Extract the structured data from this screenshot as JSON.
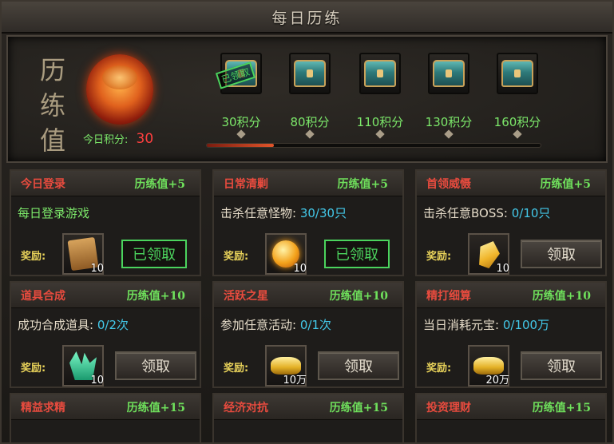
{
  "window": {
    "title": "每日历练"
  },
  "header": {
    "calligraphy": [
      "历",
      "练",
      "值"
    ],
    "today_score_label": "今日积分:",
    "today_score_value": "30",
    "progress_value": 0.2,
    "chests": [
      {
        "label": "30积分",
        "stamp": "已领取",
        "claimed": true
      },
      {
        "label": "80积分",
        "claimed": false
      },
      {
        "label": "110积分",
        "claimed": false
      },
      {
        "label": "130积分",
        "claimed": false
      },
      {
        "label": "160积分",
        "claimed": false
      }
    ]
  },
  "tasks": [
    {
      "name": "今日登录",
      "points": "历练值+5",
      "task_text": "每日登录游戏",
      "progress": "",
      "reward_label": "奖励:",
      "reward_icon": "scroll-icon",
      "reward_count": "10",
      "button": "已领取",
      "claimed": true
    },
    {
      "name": "日常清剿",
      "points": "历练值+5",
      "task_text": "击杀任意怪物:",
      "progress": "30/30只",
      "reward_label": "奖励:",
      "reward_icon": "fire-orb-icon",
      "reward_count": "10",
      "button": "已领取",
      "claimed": true
    },
    {
      "name": "首领威慑",
      "points": "历练值+5",
      "task_text": "击杀任意BOSS:",
      "progress": "0/10只",
      "reward_label": "奖励:",
      "reward_icon": "gold-crystal-icon",
      "reward_count": "10",
      "button": "领取",
      "claimed": false
    },
    {
      "name": "道具合成",
      "points": "历练值+10",
      "task_text": "成功合成道具:",
      "progress": "0/2次",
      "reward_label": "奖励:",
      "reward_icon": "jade-crystal-icon",
      "reward_count": "10",
      "button": "领取",
      "claimed": false
    },
    {
      "name": "活跃之星",
      "points": "历练值+10",
      "task_text": "参加任意活动:",
      "progress": "0/1次",
      "reward_label": "奖励:",
      "reward_icon": "gold-ingot-icon",
      "reward_count": "10万",
      "button": "领取",
      "claimed": false
    },
    {
      "name": "精打细算",
      "points": "历练值+10",
      "task_text": "当日消耗元宝:",
      "progress": "0/100万",
      "reward_label": "奖励:",
      "reward_icon": "gold-ingot-icon",
      "reward_count": "20万",
      "button": "领取",
      "claimed": false
    },
    {
      "name": "精益求精",
      "points": "历练值+15"
    },
    {
      "name": "经济对抗",
      "points": "历练值+15"
    },
    {
      "name": "投资理财",
      "points": "历练值+15"
    }
  ],
  "colors": {
    "accent_red": "#e84b3e",
    "accent_green": "#6fe15c",
    "progress_cyan": "#43c9ea"
  }
}
